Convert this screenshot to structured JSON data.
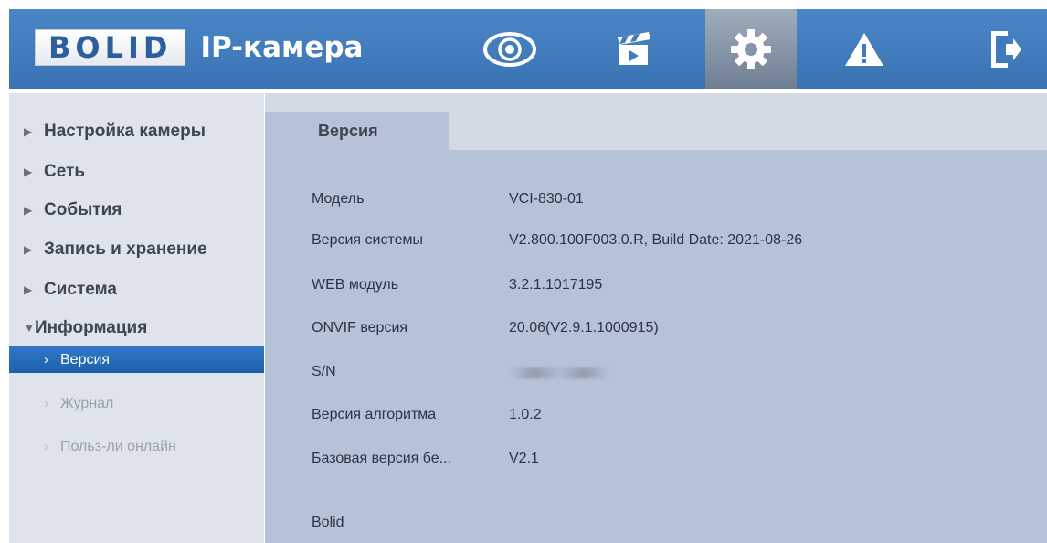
{
  "header": {
    "logo_text": "BOLID",
    "app_title": "IP-камера",
    "nav": [
      {
        "name": "live-view",
        "icon": "eye-icon"
      },
      {
        "name": "playback",
        "icon": "clapperboard-icon"
      },
      {
        "name": "settings",
        "icon": "gear-icon"
      },
      {
        "name": "alarm",
        "icon": "warning-icon"
      },
      {
        "name": "logout",
        "icon": "exit-door-icon"
      }
    ],
    "active_nav": "settings"
  },
  "sidebar": {
    "items": [
      {
        "label": "Настройка камеры",
        "expanded": false
      },
      {
        "label": "Сеть",
        "expanded": false
      },
      {
        "label": "События",
        "expanded": false
      },
      {
        "label": "Запись и хранение",
        "expanded": false
      },
      {
        "label": "Система",
        "expanded": false
      },
      {
        "label": "Информация",
        "expanded": true
      }
    ],
    "sub_items": [
      {
        "label": "Версия",
        "active": true
      },
      {
        "label": "Журнал",
        "active": false
      },
      {
        "label": "Польз-ли онлайн",
        "active": false
      }
    ]
  },
  "content": {
    "tab_label": "Версия",
    "rows": [
      {
        "key": "Модель",
        "value": "VCI-830-01"
      },
      {
        "key": "Версия системы",
        "value": "V2.800.100F003.0.R, Build Date: 2021-08-26"
      },
      {
        "key": "WEB модуль",
        "value": "3.2.1.1017195"
      },
      {
        "key": "ONVIF версия",
        "value": "20.06(V2.9.1.1000915)"
      },
      {
        "key": "S/N",
        "value": ""
      },
      {
        "key": "Версия алгоритма",
        "value": "1.0.2"
      },
      {
        "key": "Базовая версия бе...",
        "value": "V2.1"
      }
    ],
    "footer_text": "Bolid"
  },
  "colors": {
    "header_blue": "#3f7bbd",
    "active_item": "#2369b8",
    "content_bg": "#b5c2d7",
    "sidebar_bg": "#dfe4ec"
  }
}
